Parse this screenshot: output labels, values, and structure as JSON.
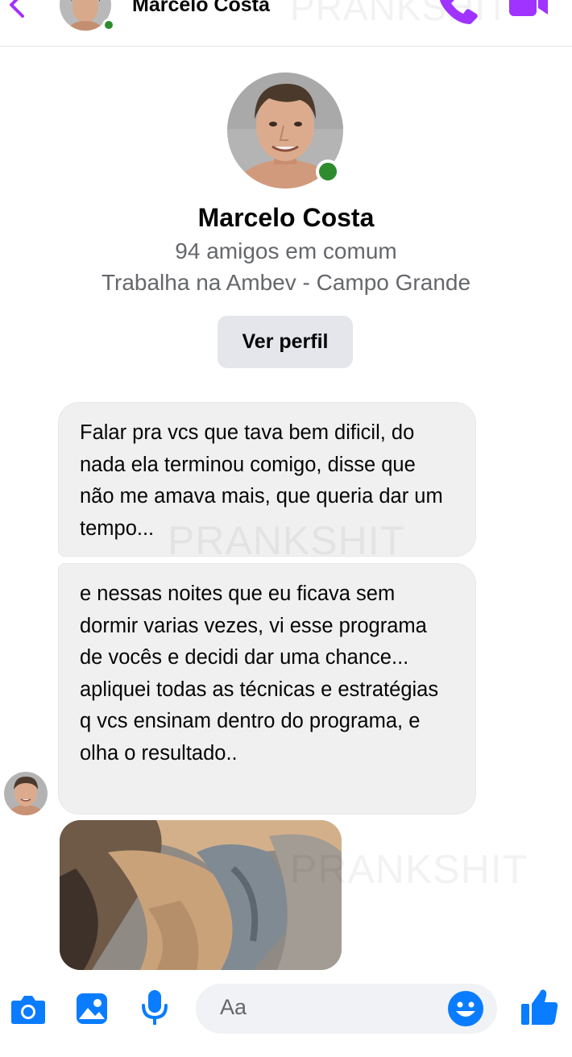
{
  "header": {
    "contact_name": "Marcelo Costa",
    "watermark": "PRANKSHIT"
  },
  "profile": {
    "name": "Marcelo Costa",
    "mutual_friends": "94 amigos em comum",
    "work": "Trabalha na Ambev - Campo Grande",
    "view_profile_label": "Ver perfil"
  },
  "messages": [
    {
      "text": "Falar pra vcs que tava bem dificil, do nada ela terminou comigo, disse que não me amava mais, que queria dar um tempo..."
    },
    {
      "text": "e nessas noites que eu ficava sem dormir varias vezes, vi esse programa de vocês e decidi dar uma chance... apliquei todas as técnicas e estratégias q vcs ensinam dentro do programa, e olha o resultado.."
    }
  ],
  "watermarks": [
    "PRANKSHIT",
    "PRANKSHIT"
  ],
  "composer": {
    "placeholder": "Aa"
  },
  "colors": {
    "accent": "#a033ff",
    "blue": "#0a7cff",
    "online": "#2e8b2e",
    "bubble": "#f0f0f0"
  },
  "icons": [
    "back-chevron-icon",
    "phone-icon",
    "video-camera-icon",
    "camera-icon",
    "image-icon",
    "microphone-icon",
    "emoji-icon",
    "thumbs-up-icon"
  ]
}
